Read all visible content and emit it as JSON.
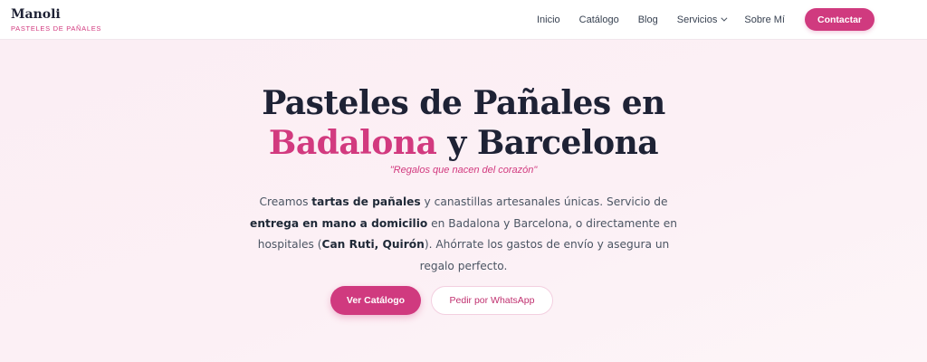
{
  "brand": {
    "name": "Manoli",
    "tagline": "PASTELES DE PAÑALES"
  },
  "nav": {
    "items": [
      "Inicio",
      "Catálogo",
      "Blog",
      "Servicios",
      "Sobre Mí"
    ],
    "contact": "Contactar"
  },
  "hero": {
    "title_line1": "Pasteles de Pañales en",
    "title_accent": "Badalona",
    "title_rest": " y Barcelona",
    "slogan": "\"Regalos que nacen del corazón\"",
    "intro": {
      "t1": "Creamos ",
      "b1": "tartas de pañales",
      "t2": " y canastillas artesanales únicas. Servicio de ",
      "b2": "entrega en mano a domicilio",
      "t3": " en Badalona y Barcelona, o directamente en hospitales (",
      "b3": "Can Ruti, Quirón",
      "t4": "). Ahórrate los gastos de envío y asegura un regalo perfecto."
    },
    "cta_primary": "Ver Catálogo",
    "cta_secondary": "Pedir por WhatsApp"
  },
  "colors": {
    "accent": "#d03a7f",
    "heading": "#1e2235",
    "hero_bg": "#fbeef4"
  }
}
